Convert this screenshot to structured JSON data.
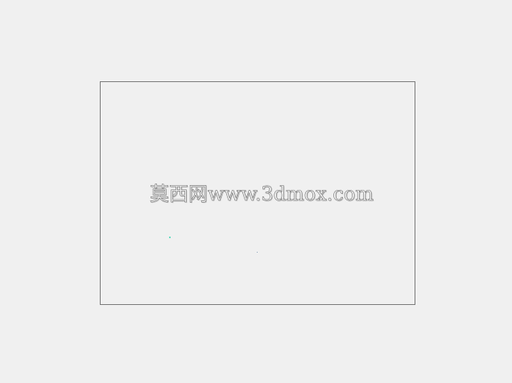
{
  "watermark": {
    "text": "莫西网www.3dmox.com"
  },
  "colors": {
    "background": "#f0f0f0",
    "frame_border": "#7a7a7a",
    "speck_primary": "#3ad6b0",
    "speck_secondary": "#6a8aa8"
  }
}
